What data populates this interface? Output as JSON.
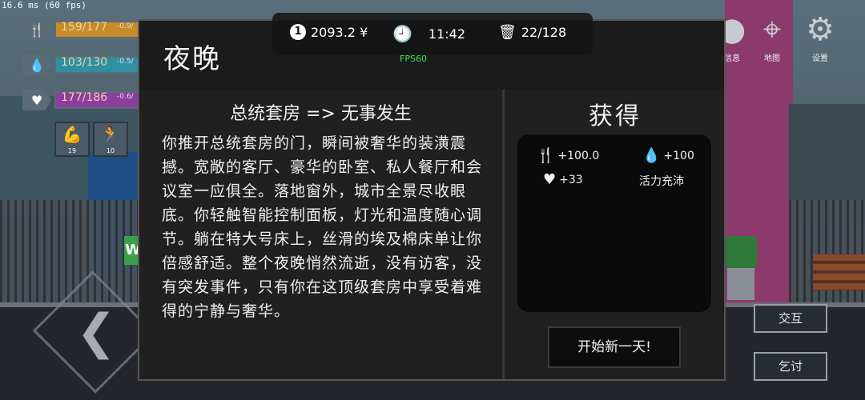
{
  "debug": {
    "frame_time": "16.6 ms (60 fps)"
  },
  "stats": [
    {
      "icon": "fork-knife-icon",
      "value": "159/177",
      "delta": "-0.9/",
      "fill_fraction": 0.9,
      "color": "#c98a2a"
    },
    {
      "icon": "water-drop-icon",
      "value": "103/130",
      "delta": "-0.5/",
      "fill_fraction": 0.79,
      "color": "#2f8fa3"
    },
    {
      "icon": "heartbeat-icon",
      "value": "177/186",
      "delta": "-0.6/",
      "fill_fraction": 0.95,
      "color": "#8a3fa0"
    }
  ],
  "skills": [
    {
      "icon": "strength-icon",
      "level": "19"
    },
    {
      "icon": "running-icon",
      "level": "10"
    }
  ],
  "topbar": {
    "money": "2093.2 ¥",
    "coin_symbol": "1",
    "time": "11:42",
    "capacity": "22/128",
    "fps": "FPS60"
  },
  "right_menu": {
    "info_label": "信息",
    "map_label": "地图",
    "settings_label": "设置"
  },
  "actions": {
    "interact": "交互",
    "beg": "乞讨"
  },
  "dialog": {
    "title": "夜晚",
    "event_title": "总统套房 => 无事发生",
    "event_text": "你推开总统套房的门，瞬间被奢华的装潢震撼。宽敞的客厅、豪华的卧室、私人餐厅和会议室一应俱全。落地窗外，城市全景尽收眼底。你轻触智能控制面板，灯光和温度随心调节。躺在特大号床上，丝滑的埃及棉床单让你倍感舒适。整个夜晚悄然流逝，没有访客，没有突发事件，只有你在这顶级套房中享受着难得的宁静与奢华。",
    "gain_title": "获得",
    "gains": {
      "food": "+100.0",
      "water": "+100",
      "health": "+33",
      "status": "活力充沛"
    },
    "new_day_button": "开始新一天!"
  }
}
